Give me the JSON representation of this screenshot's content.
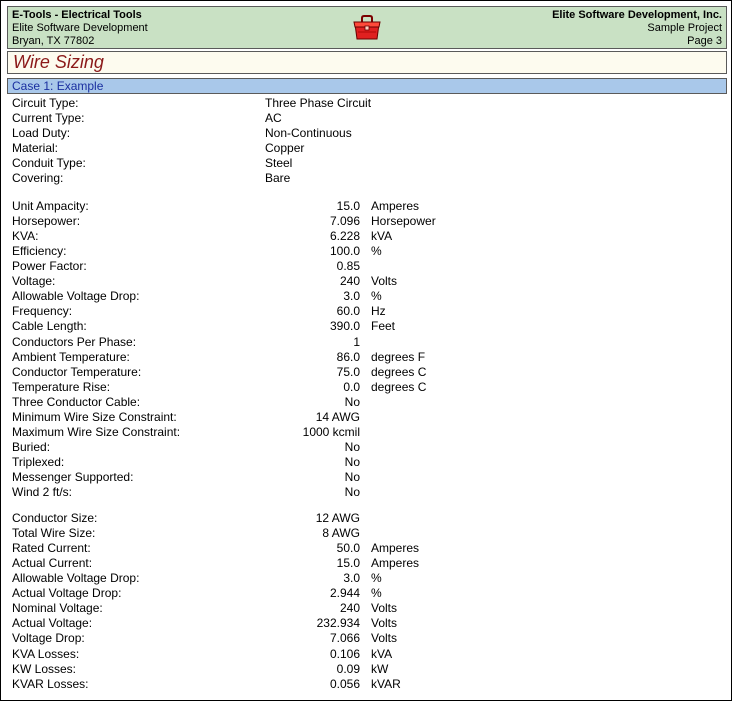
{
  "header": {
    "app_title": "E-Tools - Electrical Tools",
    "company_line": "Elite Software Development",
    "address_line": "Bryan, TX 77802",
    "company_right": "Elite Software Development, Inc.",
    "project": "Sample Project",
    "page": "Page 3"
  },
  "report_title": "Wire Sizing",
  "case_title": "Case 1: Example",
  "info_rows": [
    {
      "label": "Circuit Type:",
      "value": "Three Phase Circuit"
    },
    {
      "label": "Current Type:",
      "value": "AC"
    },
    {
      "label": "Load Duty:",
      "value": "Non-Continuous"
    },
    {
      "label": "Material:",
      "value": "Copper"
    },
    {
      "label": "Conduit Type:",
      "value": "Steel"
    },
    {
      "label": "Covering:",
      "value": "Bare"
    }
  ],
  "input_rows": [
    {
      "label": "Unit Ampacity:",
      "value": "15.0",
      "unit": "Amperes"
    },
    {
      "label": "Horsepower:",
      "value": "7.096",
      "unit": "Horsepower"
    },
    {
      "label": "KVA:",
      "value": "6.228",
      "unit": "kVA"
    },
    {
      "label": "Efficiency:",
      "value": "100.0",
      "unit": "%"
    },
    {
      "label": "Power Factor:",
      "value": "0.85",
      "unit": ""
    },
    {
      "label": "Voltage:",
      "value": "240",
      "unit": "Volts"
    },
    {
      "label": "Allowable Voltage Drop:",
      "value": "3.0",
      "unit": "%"
    },
    {
      "label": "Frequency:",
      "value": "60.0",
      "unit": "Hz"
    },
    {
      "label": "Cable Length:",
      "value": "390.0",
      "unit": "Feet"
    },
    {
      "label": "Conductors Per Phase:",
      "value": "1",
      "unit": ""
    },
    {
      "label": "Ambient Temperature:",
      "value": "86.0",
      "unit": "degrees F"
    },
    {
      "label": "Conductor Temperature:",
      "value": "75.0",
      "unit": "degrees C"
    },
    {
      "label": "Temperature Rise:",
      "value": "0.0",
      "unit": "degrees C"
    },
    {
      "label": "Three Conductor Cable:",
      "value": "No",
      "unit": ""
    },
    {
      "label": "Minimum Wire Size Constraint:",
      "value": "14 AWG",
      "unit": ""
    },
    {
      "label": "Maximum Wire Size Constraint:",
      "value": "1000 kcmil",
      "unit": ""
    },
    {
      "label": "Buried:",
      "value": "No",
      "unit": ""
    },
    {
      "label": "Triplexed:",
      "value": "No",
      "unit": ""
    },
    {
      "label": "Messenger Supported:",
      "value": "No",
      "unit": ""
    },
    {
      "label": "Wind 2 ft/s:",
      "value": "No",
      "unit": ""
    }
  ],
  "result_rows": [
    {
      "label": "Conductor Size:",
      "value": "12 AWG",
      "unit": ""
    },
    {
      "label": "Total Wire Size:",
      "value": "8 AWG",
      "unit": ""
    },
    {
      "label": "Rated Current:",
      "value": "50.0",
      "unit": "Amperes"
    },
    {
      "label": "Actual Current:",
      "value": "15.0",
      "unit": "Amperes"
    },
    {
      "label": "Allowable Voltage Drop:",
      "value": "3.0",
      "unit": "%"
    },
    {
      "label": "Actual Voltage Drop:",
      "value": "2.944",
      "unit": "%"
    },
    {
      "label": "Nominal Voltage:",
      "value": "240",
      "unit": "Volts"
    },
    {
      "label": "Actual Voltage:",
      "value": "232.934",
      "unit": "Volts"
    },
    {
      "label": "Voltage Drop:",
      "value": "7.066",
      "unit": "Volts"
    },
    {
      "label": "KVA Losses:",
      "value": "0.106",
      "unit": "kVA"
    },
    {
      "label": "KW Losses:",
      "value": "0.09",
      "unit": "kW"
    },
    {
      "label": "KVAR Losses:",
      "value": "0.056",
      "unit": "kVAR"
    }
  ],
  "colors": {
    "header_bg": "#c9e1c4",
    "title_bg": "#fdfbef",
    "title_text": "#8b1a1a",
    "case_bg": "#a9c8ea",
    "case_text": "#1a2fa0",
    "toolbox_red": "#e02020"
  },
  "icons": {
    "logo": "red-toolbox-icon"
  }
}
